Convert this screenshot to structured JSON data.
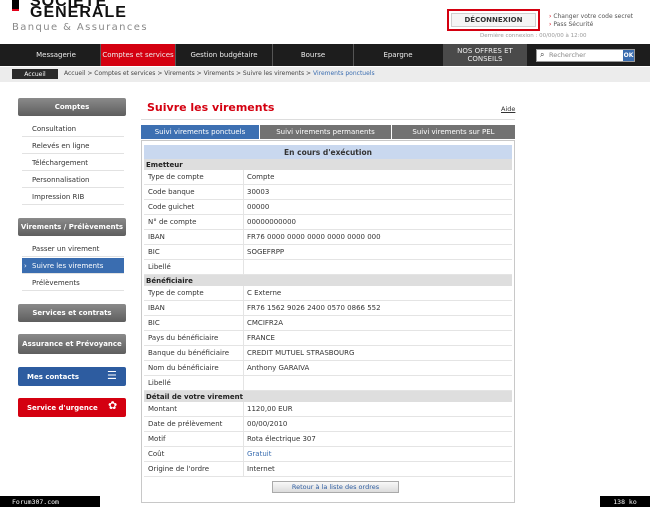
{
  "header": {
    "brand_line1": "SOCIETE",
    "brand_line2": "GENERALE",
    "brand_sub": "Banque & Assurances",
    "logout": "DÉCONNEXION",
    "links": [
      "Changer votre code secret",
      "Pass Sécurité"
    ],
    "last_login": "Dernière connexion : 00/00/00 à 12:00"
  },
  "nav": {
    "items": [
      "Messagerie",
      "Comptes et services",
      "Gestion budgétaire",
      "Bourse",
      "Epargne",
      "NOS OFFRES ET CONSEILS"
    ],
    "search_placeholder": "Rechercher",
    "search_go": "OK"
  },
  "breadcrumb": {
    "home": "Accueil",
    "path_prefix": "Accueil > Comptes et services > Virements > Virements > Suivre les virements > ",
    "path_current": "Virements ponctuels"
  },
  "sidebar": {
    "comptes_head": "Comptes",
    "comptes_items": [
      "Consultation",
      "Relevés en ligne",
      "Téléchargement",
      "Personnalisation",
      "Impression RIB"
    ],
    "virements_head": "Virements / Prélèvements",
    "virements_items": [
      "Passer un virement",
      "Suivre les virements",
      "Prélèvements"
    ],
    "services_head": "Services et contrats",
    "assurance_head": "Assurance et Prévoyance",
    "contacts": "Mes contacts",
    "urgence": "Service d'urgence",
    "colors": {
      "active": "#3a6db0",
      "contacts": "#2d5ca0",
      "urgence": "#d40010"
    }
  },
  "main": {
    "title": "Suivre les virements",
    "aide": "Aide",
    "tabs": [
      "Suivi virements ponctuels",
      "Suivi virements permanents",
      "Suivi virements sur PEL"
    ],
    "status": "En cours d'exécution",
    "emetteur_title": "Emetteur",
    "emetteur_rows": [
      {
        "label": "Type de compte",
        "value": "Compte"
      },
      {
        "label": "Code banque",
        "value": "30003"
      },
      {
        "label": "Code guichet",
        "value": "00000"
      },
      {
        "label": "N° de compte",
        "value": "00000000000"
      },
      {
        "label": "IBAN",
        "value": "FR76 0000 0000 0000 0000 0000 000"
      },
      {
        "label": "BIC",
        "value": "SOGEFRPP"
      },
      {
        "label": "Libellé",
        "value": ""
      }
    ],
    "beneficiaire_title": "Bénéficiaire",
    "beneficiaire_rows": [
      {
        "label": "Type de compte",
        "value": "C Externe"
      },
      {
        "label": "IBAN",
        "value": "FR76 1562 9026 2400 0570 0866 552"
      },
      {
        "label": "BIC",
        "value": "CMCIFR2A"
      },
      {
        "label": "Pays du bénéficiaire",
        "value": "FRANCE"
      },
      {
        "label": "Banque du bénéficiaire",
        "value": "CREDIT MUTUEL STRASBOURG"
      },
      {
        "label": "Nom du bénéficiaire",
        "value": "Anthony GARAIVA"
      },
      {
        "label": "Libellé",
        "value": ""
      }
    ],
    "detail_title": "Détail de votre virement",
    "detail_rows": [
      {
        "label": "Montant",
        "value": "1120,00 EUR"
      },
      {
        "label": "Date de prélèvement",
        "value": "00/00/2010"
      },
      {
        "label": "Motif",
        "value": "Rota électrique 307"
      },
      {
        "label": "Coût",
        "value": "Gratuit"
      },
      {
        "label": "Origine de l'ordre",
        "value": "Internet"
      }
    ],
    "back_button": "Retour à la liste des ordres"
  },
  "overlay": {
    "forum": "Forum307.com",
    "size": "138 ko"
  }
}
